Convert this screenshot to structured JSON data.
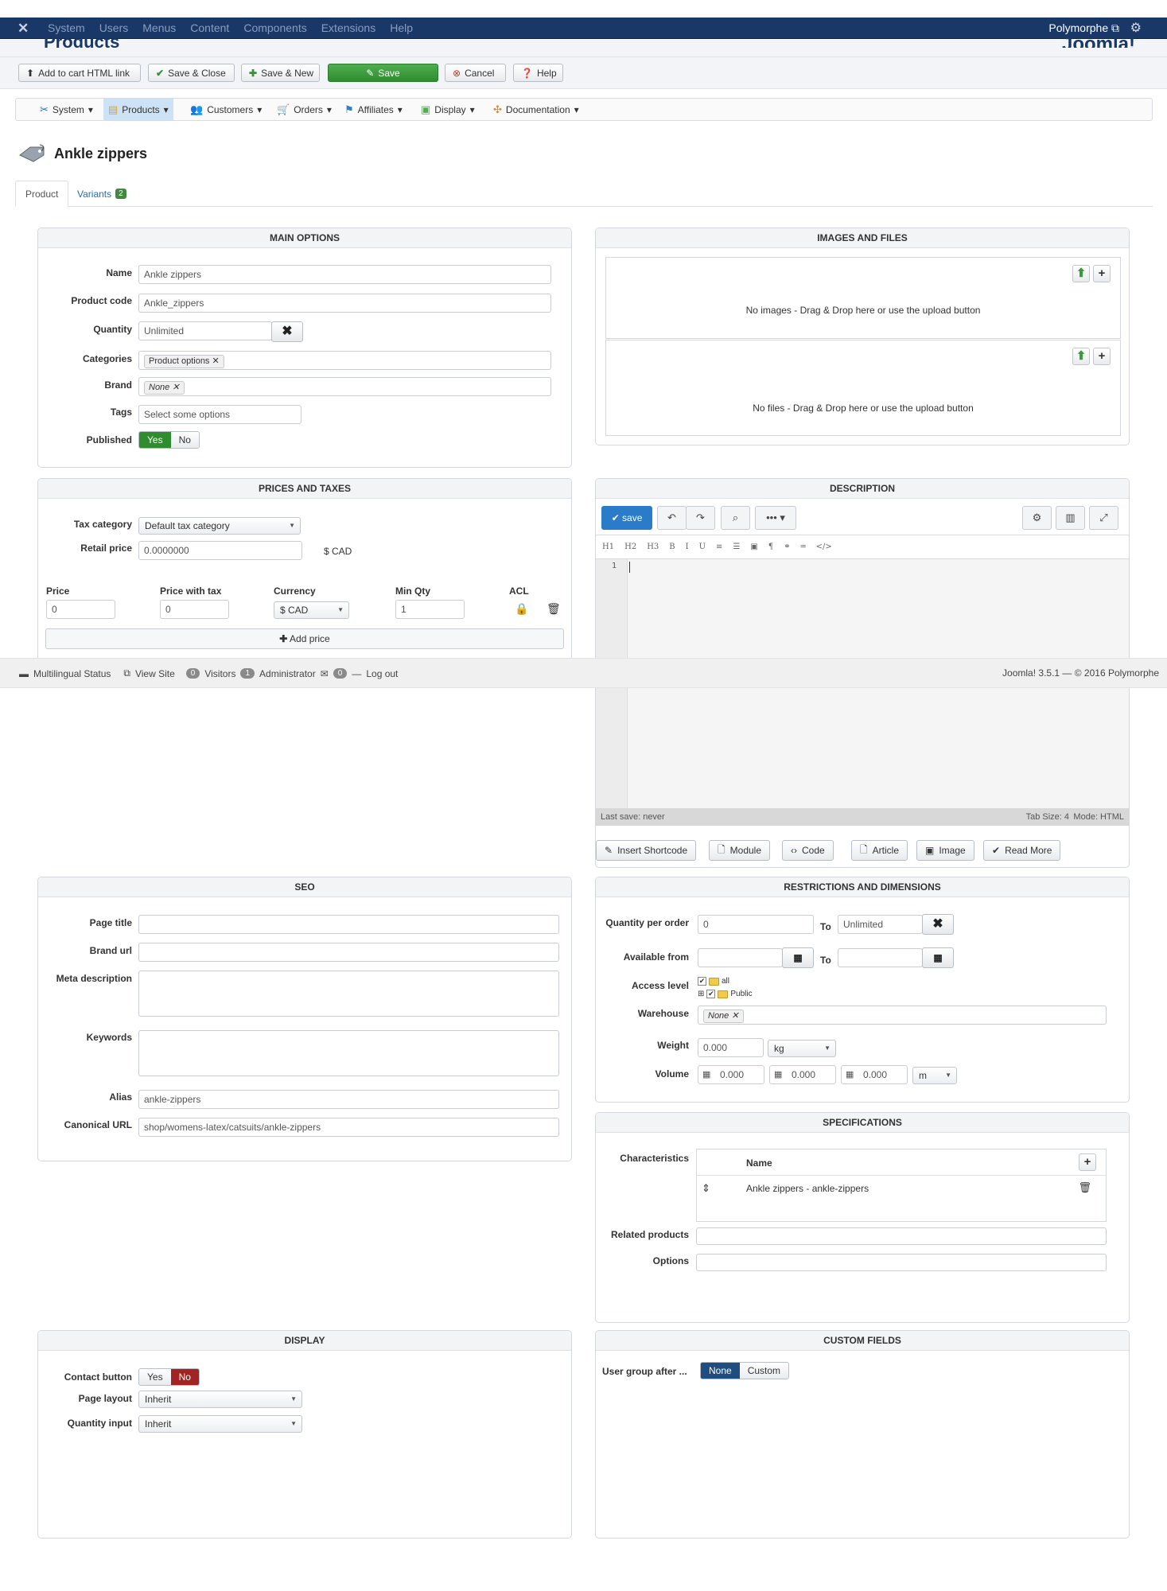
{
  "topnav": {
    "menu": [
      "System",
      "Users",
      "Menus",
      "Content",
      "Components",
      "Extensions",
      "Help"
    ],
    "user": "Polymorphe",
    "page_title": "Products",
    "brand": "Joomla!"
  },
  "toolbar": {
    "add_cart": "Add to cart HTML link",
    "save_close": "Save & Close",
    "save_new": "Save & New",
    "save": "Save",
    "cancel": "Cancel",
    "help": "Help"
  },
  "component_menu": [
    "System",
    "Products",
    "Customers",
    "Orders",
    "Affiliates",
    "Display",
    "Documentation"
  ],
  "heading": "Ankle zippers",
  "tabs": {
    "product": "Product",
    "variants": "Variants",
    "variants_count": "2"
  },
  "main_options": {
    "title": "MAIN OPTIONS",
    "name_label": "Name",
    "name": "Ankle zippers",
    "code_label": "Product code",
    "code": "Ankle_zippers",
    "qty_label": "Quantity",
    "qty": "Unlimited",
    "cat_label": "Categories",
    "cat": "Product options",
    "brand_label": "Brand",
    "brand": "None",
    "tags_label": "Tags",
    "tags_placeholder": "Select some options",
    "pub_label": "Published",
    "yes": "Yes",
    "no": "No"
  },
  "prices": {
    "title": "PRICES AND TAXES",
    "taxcat_label": "Tax category",
    "taxcat": "Default tax category",
    "retail_label": "Retail price",
    "retail": "0.0000000",
    "retail_unit": "$ CAD",
    "cols": [
      "Price",
      "Price with tax",
      "Currency",
      "Min Qty",
      "ACL"
    ],
    "price": "0",
    "price_tax": "0",
    "currency": "$ CAD",
    "min_qty": "1",
    "add_price": "Add price"
  },
  "images": {
    "title": "IMAGES AND FILES",
    "no_images": "No images - Drag & Drop here or use the upload button",
    "no_files": "No files - Drag & Drop here or use the upload button"
  },
  "description": {
    "title": "DESCRIPTION",
    "save": "save",
    "fmt": [
      "H1",
      "H2",
      "H3",
      "B",
      "I",
      "U",
      "≡",
      "☰",
      "▣",
      "¶",
      "⚭",
      "═",
      "</>"
    ],
    "line": "1",
    "last_save": "Last save: never",
    "tab_size": "Tab Size: 4",
    "mode": "Mode: HTML",
    "buttons": [
      "Insert Shortcode",
      "Module",
      "Code",
      "Article",
      "Image",
      "Read More"
    ]
  },
  "statusbar": {
    "multilingual": "Multilingual Status",
    "view_site": "View Site",
    "visitors_count": "0",
    "visitors": "Visitors",
    "admin_count": "1",
    "admin": "Administrator",
    "msg_count": "0",
    "logout": "Log out",
    "version": "Joomla! 3.5.1 — © 2016 Polymorphe"
  },
  "seo": {
    "title": "SEO",
    "page_title_label": "Page title",
    "brand_url_label": "Brand url",
    "meta_label": "Meta description",
    "keywords_label": "Keywords",
    "alias_label": "Alias",
    "alias": "ankle-zippers",
    "canonical_label": "Canonical URL",
    "canonical": "shop/womens-latex/catsuits/ankle-zippers"
  },
  "restrictions": {
    "title": "RESTRICTIONS AND DIMENSIONS",
    "qpo_label": "Quantity per order",
    "qpo_from": "0",
    "to": "To",
    "qpo_to": "Unlimited",
    "avail_label": "Available from",
    "access_label": "Access level",
    "access_all": "all",
    "access_public": "Public",
    "warehouse_label": "Warehouse",
    "warehouse": "None",
    "weight_label": "Weight",
    "weight": "0.000",
    "weight_unit": "kg",
    "volume_label": "Volume",
    "vol1": "0.000",
    "vol2": "0.000",
    "vol3": "0.000",
    "vol_unit": "m"
  },
  "specifications": {
    "title": "SPECIFICATIONS",
    "char_label": "Characteristics",
    "name_col": "Name",
    "row": "Ankle zippers - ankle-zippers",
    "related_label": "Related products",
    "options_label": "Options"
  },
  "display": {
    "title": "DISPLAY",
    "contact_label": "Contact button",
    "yes": "Yes",
    "no": "No",
    "layout_label": "Page layout",
    "layout": "Inherit",
    "qtyinput_label": "Quantity input",
    "qtyinput": "Inherit"
  },
  "custom_fields": {
    "title": "CUSTOM FIELDS",
    "ug_label": "User group after ...",
    "none": "None",
    "custom": "Custom"
  }
}
